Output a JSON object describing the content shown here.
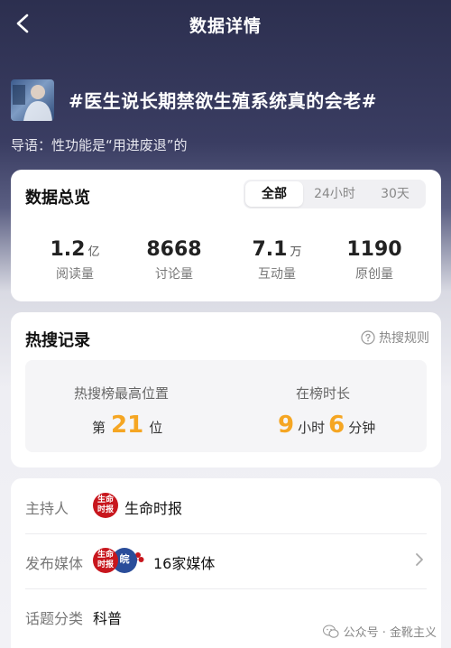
{
  "nav": {
    "title": "数据详情"
  },
  "topic": {
    "title": "#医生说长期禁欲生殖系统真的会老#",
    "guide": "导语：性功能是“用进废退”的"
  },
  "overview": {
    "title": "数据总览",
    "tabs": [
      "全部",
      "24小时",
      "30天"
    ],
    "active_tab": "全部",
    "stats": [
      {
        "value": "1.2",
        "unit": "亿",
        "label": "阅读量"
      },
      {
        "value": "8668",
        "unit": "",
        "label": "讨论量"
      },
      {
        "value": "7.1",
        "unit": "万",
        "label": "互动量"
      },
      {
        "value": "1190",
        "unit": "",
        "label": "原创量"
      }
    ]
  },
  "hot": {
    "title": "热搜记录",
    "rule_label": "热搜规则",
    "peak_label": "热搜榜最高位置",
    "peak_prefix": "第",
    "peak_value": "21",
    "peak_suffix": "位",
    "duration_label": "在榜时长",
    "hours": "9",
    "hours_unit": "小时",
    "minutes": "6",
    "minutes_unit": "分钟"
  },
  "info": {
    "host_label": "主持人",
    "host_value": "生命时报",
    "host_seal": "生命时报",
    "media_label": "发布媒体",
    "media_value": "16家媒体",
    "media_seal_blue": "皖",
    "category_label": "话题分类",
    "category_value": "科普"
  },
  "watermark": "公众号 · 金靴主义",
  "colors": {
    "accent_orange": "#f5a623",
    "seal_red": "#c8161d"
  }
}
